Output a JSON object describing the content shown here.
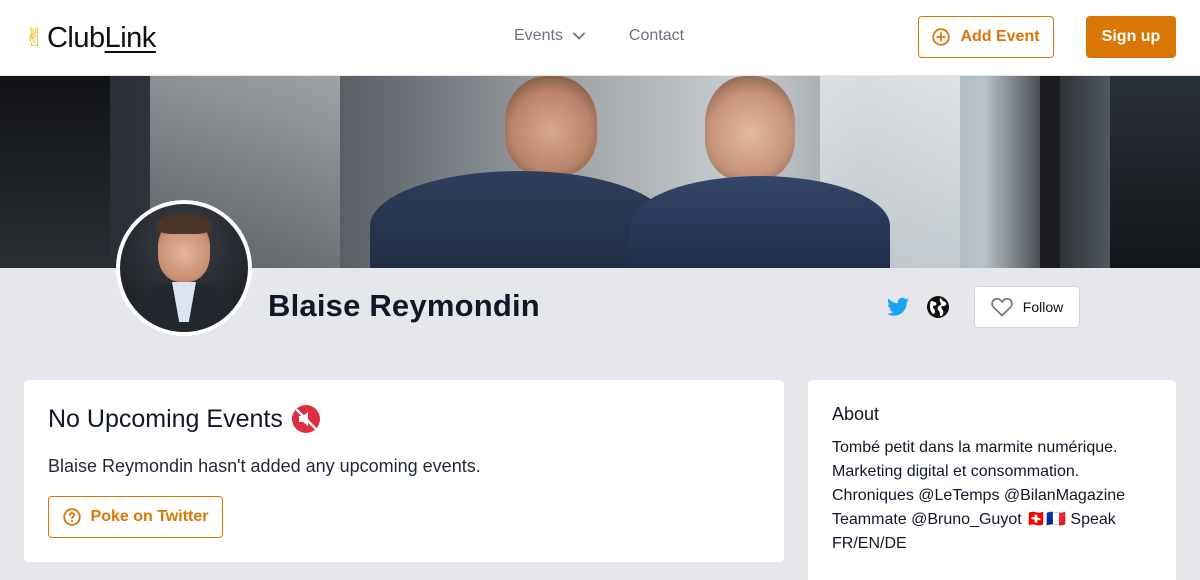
{
  "header": {
    "logo_text_club": "Club",
    "logo_text_link": "Link",
    "logo_mark": "✌",
    "nav": {
      "events_label": "Events",
      "contact_label": "Contact"
    },
    "add_event_label": "Add Event",
    "signup_label": "Sign up"
  },
  "profile": {
    "name": "Blaise Reymondin",
    "follow_label": "Follow",
    "social_icons": [
      "twitter-icon",
      "globe-icon"
    ]
  },
  "events_card": {
    "title": "No Upcoming Events",
    "title_icon": "🔇",
    "message": "Blaise Reymondin hasn't added any upcoming events.",
    "poke_label": "Poke on Twitter"
  },
  "about_card": {
    "title": "About",
    "text": "Tombé petit dans la marmite numérique. Marketing digital et consommation. Chroniques @LeTemps @BilanMagazine Teammate @Bruno_Guyot 🇨🇭🇫🇷 Speak FR/EN/DE"
  },
  "colors": {
    "accent": "#d97706",
    "background": "#e5e7eb",
    "twitter": "#1da1f2"
  }
}
